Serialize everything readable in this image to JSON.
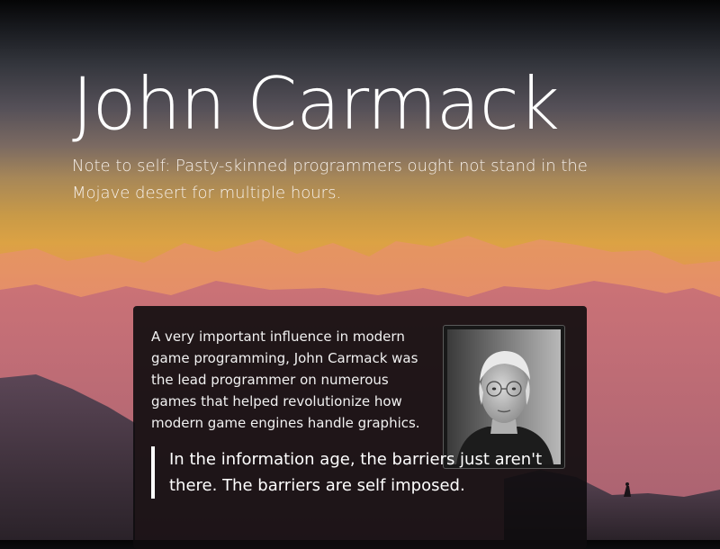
{
  "hero": {
    "title": "John Carmack",
    "subtitle": "Note to self: Pasty-skinned programmers ought not stand in the Mojave desert for multiple hours."
  },
  "card": {
    "bio": "A very important influence in modern game programming, John Carmack was the lead programmer on numerous games that helped revolutionize how modern game engines handle graphics.",
    "portrait_icon": "person-photo",
    "quote": "In the information age, the barriers just aren't there. The barriers are self imposed."
  },
  "colors": {
    "card_background": "#0e0c0e",
    "text": "#ffffff",
    "quote_border": "#ffffff"
  }
}
